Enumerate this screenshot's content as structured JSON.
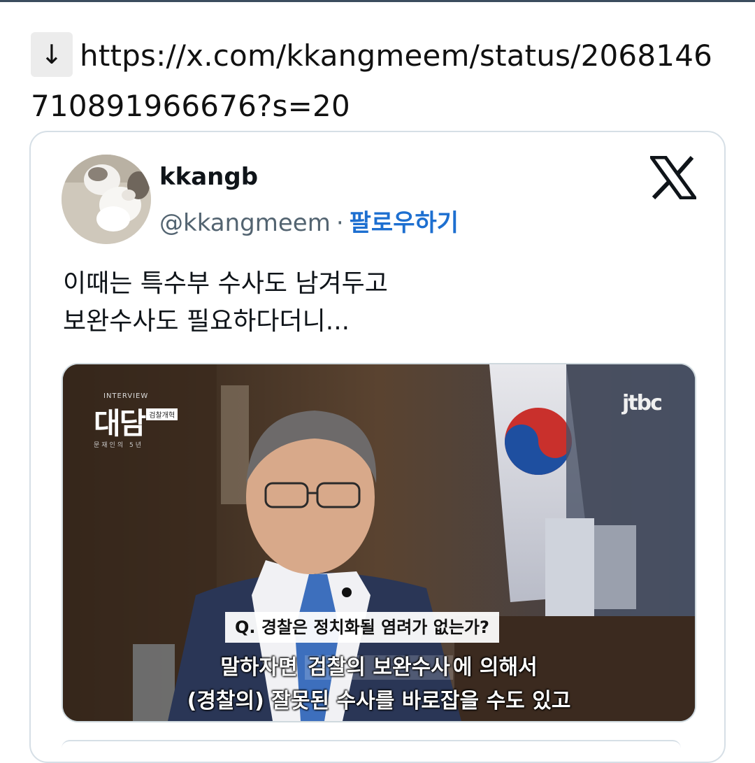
{
  "link": {
    "arrow": "↓",
    "url": "https://x.com/kkangmeem/status/2068146710891966676?s=20"
  },
  "tweet": {
    "display_name": "kkangb",
    "handle": "@kkangmeem",
    "separator": "·",
    "follow_label": "팔로우하기",
    "text_line_1": "이때는 특수부 수사도 남겨두고",
    "text_line_2": "보완수사도 필요하다더니...",
    "logo_icon": "x-logo-icon"
  },
  "media": {
    "show_small": "INTERVIEW",
    "show_title": "대담",
    "show_tag": "검찰개혁",
    "show_sub": "문재인의 5년",
    "broadcaster": "jtbc",
    "question": "Q. 경찰은 정치화될 염려가 없는가?",
    "caption_1_a": "말하자면 ",
    "caption_1_b": "검찰의 보완수사",
    "caption_1_c": "에 의해서",
    "caption_2": "(경찰의) 잘못된 수사를 바로잡을 수도 있고"
  },
  "colors": {
    "follow_blue": "#1d6fd0",
    "handle_gray": "#536471",
    "border": "#d6dfe6"
  }
}
